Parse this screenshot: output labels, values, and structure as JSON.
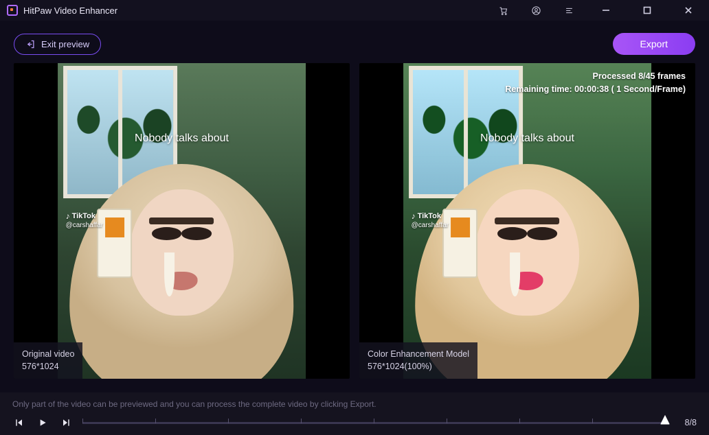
{
  "app": {
    "title": "HitPaw Video Enhancer"
  },
  "toolbar": {
    "exit_label": "Exit preview",
    "export_label": "Export"
  },
  "panels": {
    "video_caption": "Nobody talks about",
    "watermark_brand": "TikTok",
    "watermark_handle": "@carshaffar",
    "original": {
      "title": "Original video",
      "resolution": "576*1024"
    },
    "enhanced": {
      "title": "Color Enhancement Model",
      "resolution": "576*1024(100%)",
      "processed_line": "Processed 8/45 frames",
      "remaining_line": "Remaining time: 00:00:38 ( 1 Second/Frame)"
    }
  },
  "footer": {
    "hint": "Only part of the video can be previewed and you can process the complete video by clicking Export.",
    "frame_counter": "8/8"
  }
}
